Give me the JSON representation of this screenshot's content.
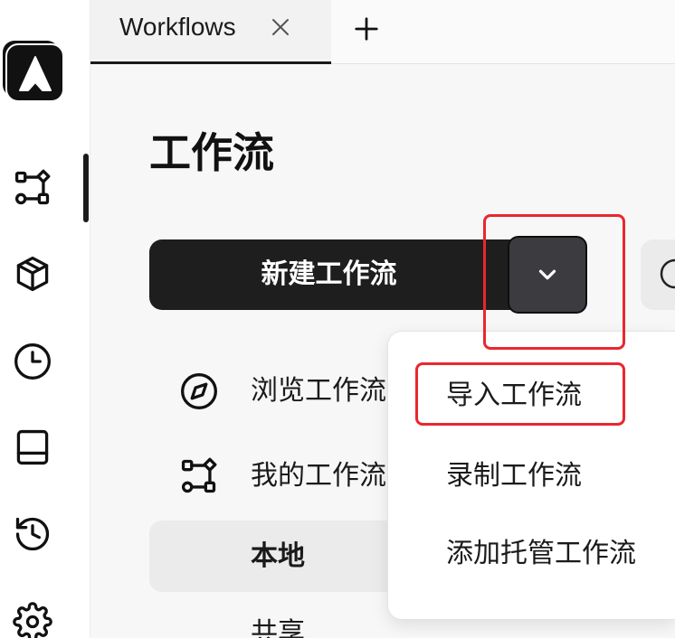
{
  "tabs": {
    "items": [
      {
        "label": "Workflows",
        "active": true,
        "close_icon": "close-icon"
      }
    ],
    "add_icon": "plus-icon"
  },
  "sidebar": {
    "logo_icon": "app-logo-icon",
    "items": [
      {
        "icon": "workflow-icon",
        "active": true
      },
      {
        "icon": "cube-icon"
      },
      {
        "icon": "clock-icon"
      },
      {
        "icon": "tray-icon"
      },
      {
        "icon": "history-icon"
      },
      {
        "icon": "gear-icon"
      }
    ]
  },
  "main": {
    "title": "工作流",
    "new_workflow_button": {
      "label": "新建工作流",
      "toggle_icon": "chevron-down-icon"
    },
    "search_icon": "search-icon",
    "nav": [
      {
        "label": "浏览工作流",
        "icon": "compass-icon"
      },
      {
        "label": "我的工作流",
        "icon": "workflow-icon"
      },
      {
        "label": "本地",
        "selected": true
      },
      {
        "label": "共享"
      }
    ]
  },
  "new_workflow_menu": {
    "open": true,
    "items": [
      {
        "label": "导入工作流"
      },
      {
        "label": "录制工作流"
      },
      {
        "label": "添加托管工作流"
      }
    ]
  },
  "colors": {
    "page_background": "#f7f7f7",
    "primary_button": "#1e1e1e",
    "dropdown_toggle": "#3b3b40",
    "selected_row": "#ebebeb",
    "annotation": "#e8282d"
  }
}
